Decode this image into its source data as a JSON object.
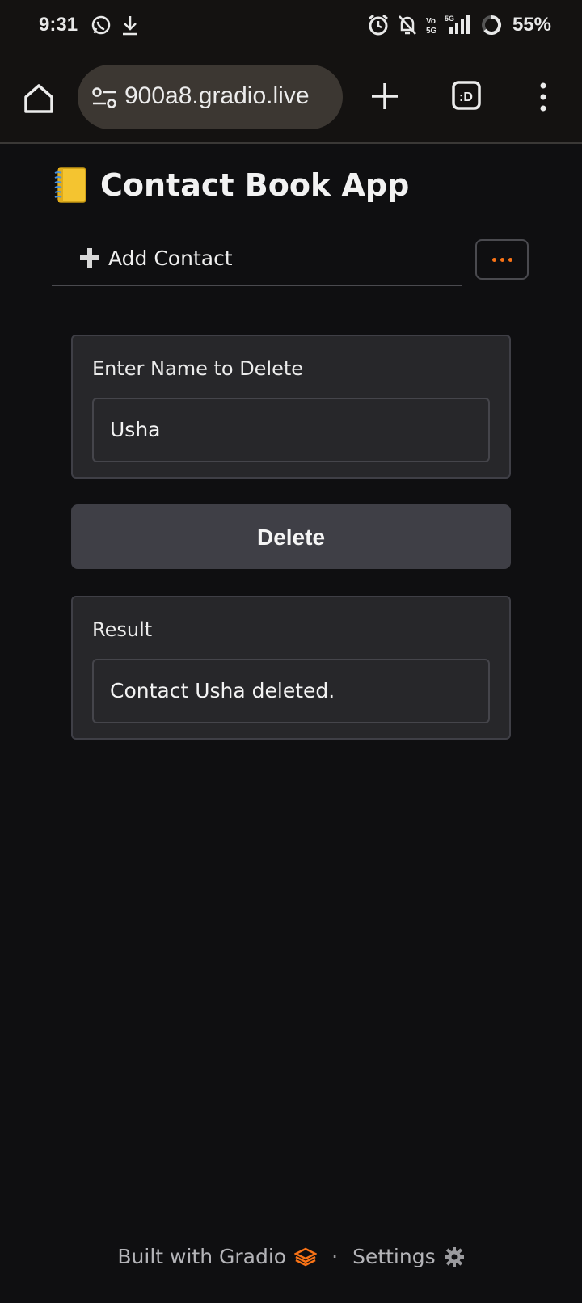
{
  "status_bar": {
    "time": "9:31",
    "battery": "55%",
    "network_label": "5G",
    "volte_label": "Vo 5G"
  },
  "browser": {
    "url": "900a8.gradio.live"
  },
  "app": {
    "title": "Contact Book App",
    "tab_label": "Add Contact"
  },
  "delete_panel": {
    "label": "Enter Name to Delete",
    "value": "Usha"
  },
  "delete_button_label": "Delete",
  "result_panel": {
    "label": "Result",
    "value": "Contact Usha deleted."
  },
  "footer": {
    "built_with": "Built with Gradio",
    "separator": "·",
    "settings": "Settings"
  },
  "colors": {
    "accent": "#f97316",
    "background": "#0f0f11",
    "panel": "#27272a",
    "button": "#3f3f46"
  }
}
